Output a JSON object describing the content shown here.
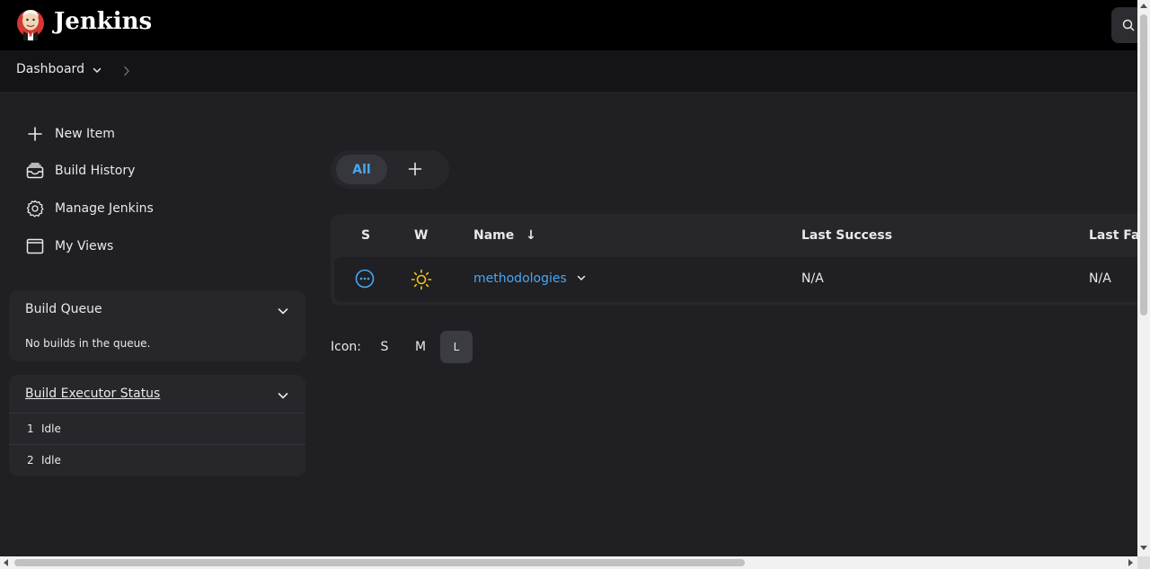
{
  "header": {
    "brand": "Jenkins",
    "logo_icon": "jenkins-butler-logo",
    "search_icon": "search-icon"
  },
  "breadcrumb": {
    "items": [
      "Dashboard"
    ]
  },
  "sidebar": {
    "tasks": [
      {
        "label": "New Item",
        "icon": "plus-icon"
      },
      {
        "label": "Build History",
        "icon": "build-history-icon"
      },
      {
        "label": "Manage Jenkins",
        "icon": "gear-icon"
      },
      {
        "label": "My Views",
        "icon": "window-icon"
      }
    ],
    "build_queue": {
      "title": "Build Queue",
      "empty_text": "No builds in the queue."
    },
    "executors": {
      "title": "Build Executor Status",
      "rows": [
        {
          "num": "1",
          "state": "Idle"
        },
        {
          "num": "2",
          "state": "Idle"
        }
      ]
    }
  },
  "views": {
    "tabs": [
      {
        "label": "All",
        "active": true
      }
    ],
    "add_icon": "plus-icon"
  },
  "table": {
    "headers": {
      "status": "S",
      "weather": "W",
      "name": "Name",
      "name_sort": "↓",
      "last_success": "Last Success",
      "last_failure": "Last Fa"
    },
    "rows": [
      {
        "status_icon": "in-progress-ellipsis-icon",
        "weather_icon": "sunny-weather-icon",
        "name": "methodologies",
        "last_success": "N/A",
        "last_failure": "N/A"
      }
    ]
  },
  "icon_size": {
    "label": "Icon:",
    "options": [
      "S",
      "M",
      "L"
    ],
    "selected": "L"
  },
  "colors": {
    "accent": "#4aa8f0",
    "weather_sun": "#f5c518",
    "background": "#1f1f24",
    "header": "#000000"
  }
}
